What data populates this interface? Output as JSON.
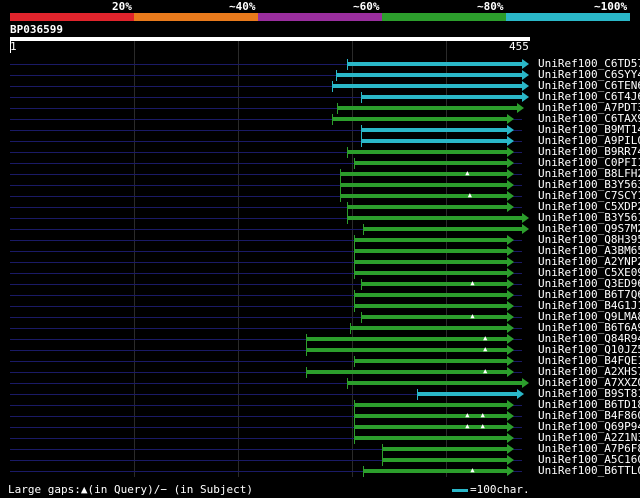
{
  "scale": {
    "ticks": [
      "20%",
      "~40%",
      "~60%",
      "~80%",
      "~100%"
    ],
    "colors": [
      "#e0242c",
      "#e87a1c",
      "#9a2e9e",
      "#2c9e2c",
      "#2ab7c8"
    ]
  },
  "query": {
    "id": "BP036599",
    "start": "1",
    "end": "455"
  },
  "colors": {
    "cyan": "#2ab7c8",
    "green": "#2c9e2c",
    "track": "#1a1a66"
  },
  "hits": [
    {
      "name": "UniRef100_C6TD57",
      "start": 0.658,
      "end": 1.0,
      "color": "cyan",
      "gaps": []
    },
    {
      "name": "UniRef100_C6SYY4",
      "start": 0.636,
      "end": 1.0,
      "color": "cyan",
      "gaps": []
    },
    {
      "name": "UniRef100_C6TEN6",
      "start": 0.628,
      "end": 1.0,
      "color": "cyan",
      "gaps": []
    },
    {
      "name": "UniRef100_C6T4J6",
      "start": 0.685,
      "end": 1.0,
      "color": "cyan",
      "gaps": []
    },
    {
      "name": "UniRef100_A7PDT3",
      "start": 0.638,
      "end": 0.99,
      "color": "green",
      "gaps": []
    },
    {
      "name": "UniRef100_C6TAX9",
      "start": 0.628,
      "end": 0.97,
      "color": "green",
      "gaps": []
    },
    {
      "name": "UniRef100_B9MT14",
      "start": 0.685,
      "end": 0.97,
      "color": "cyan",
      "gaps": []
    },
    {
      "name": "UniRef100_A9PIL0",
      "start": 0.685,
      "end": 0.97,
      "color": "cyan",
      "gaps": []
    },
    {
      "name": "UniRef100_B9RR74",
      "start": 0.658,
      "end": 0.97,
      "color": "green",
      "gaps": []
    },
    {
      "name": "UniRef100_C0PFI1",
      "start": 0.672,
      "end": 0.97,
      "color": "green",
      "gaps": []
    },
    {
      "name": "UniRef100_B8LFH2",
      "start": 0.645,
      "end": 0.97,
      "color": "green",
      "gaps": [
        0.895
      ]
    },
    {
      "name": "UniRef100_B3Y563",
      "start": 0.645,
      "end": 0.97,
      "color": "green",
      "gaps": []
    },
    {
      "name": "UniRef100_C7SCY1",
      "start": 0.645,
      "end": 0.97,
      "color": "green",
      "gaps": [
        0.9
      ]
    },
    {
      "name": "UniRef100_C5XDP2",
      "start": 0.658,
      "end": 0.97,
      "color": "green",
      "gaps": []
    },
    {
      "name": "UniRef100_B3Y561",
      "start": 0.658,
      "end": 1.0,
      "color": "green",
      "gaps": []
    },
    {
      "name": "UniRef100_Q9S7M2",
      "start": 0.69,
      "end": 1.0,
      "color": "green",
      "gaps": []
    },
    {
      "name": "UniRef100_Q8H395",
      "start": 0.672,
      "end": 0.97,
      "color": "green",
      "gaps": []
    },
    {
      "name": "UniRef100_A3BM65",
      "start": 0.672,
      "end": 0.97,
      "color": "green",
      "gaps": []
    },
    {
      "name": "UniRef100_A2YNP2",
      "start": 0.672,
      "end": 0.97,
      "color": "green",
      "gaps": []
    },
    {
      "name": "UniRef100_C5XE09",
      "start": 0.672,
      "end": 0.97,
      "color": "green",
      "gaps": []
    },
    {
      "name": "UniRef100_Q3ED96",
      "start": 0.685,
      "end": 0.97,
      "color": "green",
      "gaps": [
        0.905
      ]
    },
    {
      "name": "UniRef100_B6T7Q6",
      "start": 0.672,
      "end": 0.97,
      "color": "green",
      "gaps": []
    },
    {
      "name": "UniRef100_B4G1J1",
      "start": 0.672,
      "end": 0.97,
      "color": "green",
      "gaps": []
    },
    {
      "name": "UniRef100_Q9LMA8",
      "start": 0.685,
      "end": 0.97,
      "color": "green",
      "gaps": [
        0.905
      ]
    },
    {
      "name": "UniRef100_B6T6A9",
      "start": 0.665,
      "end": 0.97,
      "color": "green",
      "gaps": []
    },
    {
      "name": "UniRef100_Q84R94",
      "start": 0.578,
      "end": 0.97,
      "color": "green",
      "gaps": [
        0.93
      ]
    },
    {
      "name": "UniRef100_Q10JZ5",
      "start": 0.578,
      "end": 0.97,
      "color": "green",
      "gaps": [
        0.93
      ]
    },
    {
      "name": "UniRef100_B4FQE1",
      "start": 0.672,
      "end": 0.97,
      "color": "green",
      "gaps": []
    },
    {
      "name": "UniRef100_A2XHS7",
      "start": 0.578,
      "end": 0.97,
      "color": "green",
      "gaps": [
        0.93
      ]
    },
    {
      "name": "UniRef100_A7XXZ0",
      "start": 0.658,
      "end": 1.0,
      "color": "green",
      "gaps": []
    },
    {
      "name": "UniRef100_B9ST81",
      "start": 0.795,
      "end": 0.99,
      "color": "cyan",
      "gaps": []
    },
    {
      "name": "UniRef100_B6TD18",
      "start": 0.672,
      "end": 0.97,
      "color": "green",
      "gaps": []
    },
    {
      "name": "UniRef100_B4F860",
      "start": 0.672,
      "end": 0.97,
      "color": "green",
      "gaps": [
        0.895,
        0.925
      ]
    },
    {
      "name": "UniRef100_Q69P94",
      "start": 0.672,
      "end": 0.97,
      "color": "green",
      "gaps": [
        0.895,
        0.925
      ]
    },
    {
      "name": "UniRef100_A2Z1N3",
      "start": 0.672,
      "end": 0.97,
      "color": "green",
      "gaps": []
    },
    {
      "name": "UniRef100_A7P6F8",
      "start": 0.727,
      "end": 0.97,
      "color": "green",
      "gaps": []
    },
    {
      "name": "UniRef100_A5C160",
      "start": 0.727,
      "end": 0.97,
      "color": "green",
      "gaps": []
    },
    {
      "name": "UniRef100_B6TTL0",
      "start": 0.69,
      "end": 0.97,
      "color": "green",
      "gaps": [
        0.905
      ]
    }
  ],
  "legend": {
    "gaps_text": "Large gaps:▲(in Query)/− (in Subject)",
    "scale_text": "=100char."
  }
}
